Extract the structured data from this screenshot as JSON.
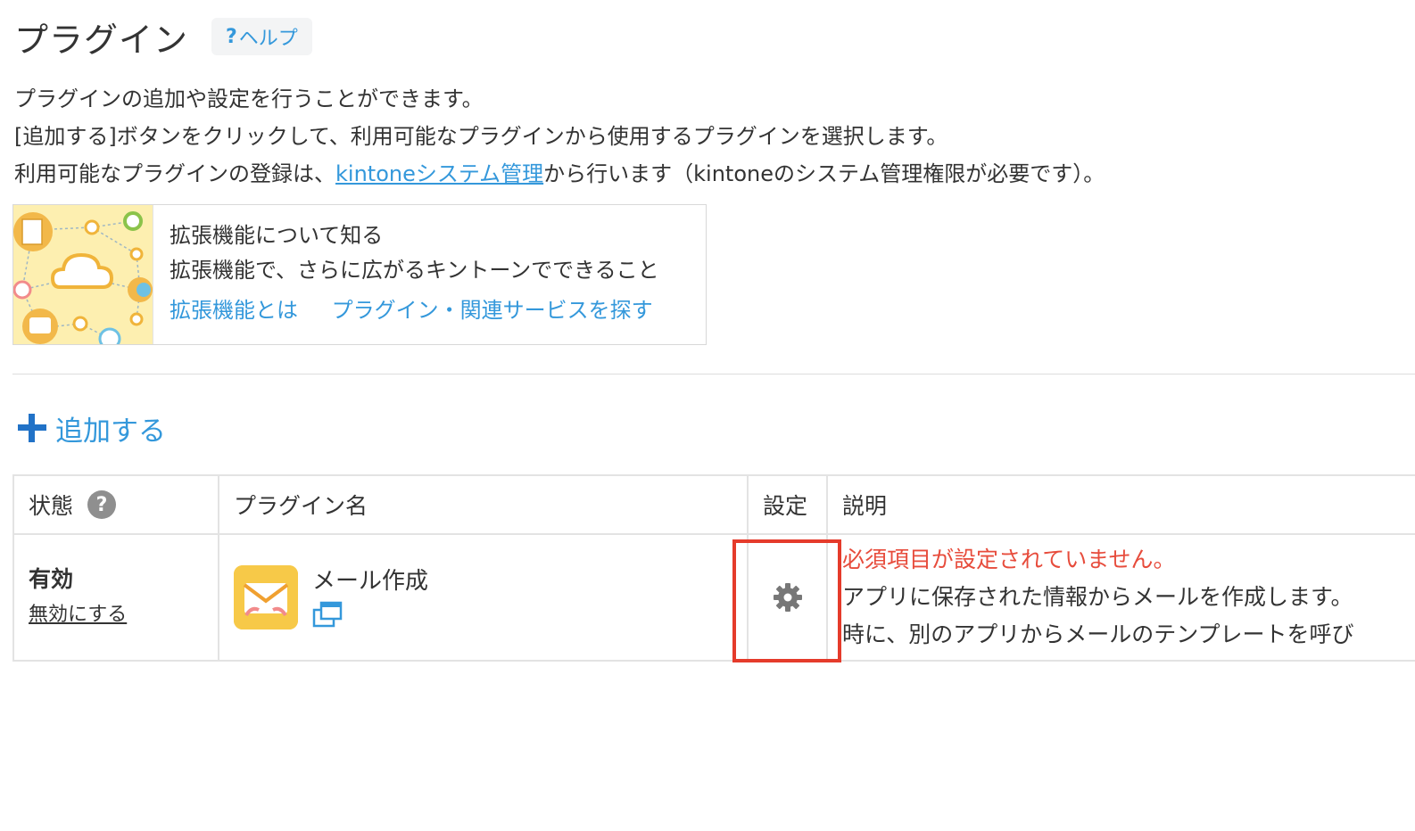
{
  "header": {
    "title": "プラグイン",
    "help_label": "ヘルプ",
    "help_mark": "?"
  },
  "intro": {
    "line1": "プラグインの追加や設定を行うことができます。",
    "line2": "[追加する]ボタンをクリックして、利用可能なプラグインから使用するプラグインを選択します。",
    "line3_pre": "利用可能なプラグインの登録は、",
    "line3_link": "kintoneシステム管理",
    "line3_post": "から行います（kintoneのシステム管理権限が必要です）。"
  },
  "promo": {
    "title": "拡張機能について知る",
    "subtitle": "拡張機能で、さらに広がるキントーンでできること",
    "link1": "拡張機能とは",
    "link2": "プラグイン・関連サービスを探す"
  },
  "add_button": {
    "label": "追加する"
  },
  "table": {
    "headers": {
      "status": "状態",
      "status_help": "?",
      "name": "プラグイン名",
      "settings": "設定",
      "description": "説明"
    },
    "rows": [
      {
        "status": "有効",
        "toggle": "無効にする",
        "name": "メール作成",
        "warning": "必須項目が設定されていません。",
        "desc_line1": "アプリに保存された情報からメールを作成します。",
        "desc_line2": "時に、別のアプリからメールのテンプレートを呼び"
      }
    ]
  },
  "colors": {
    "link": "#3498db",
    "warning": "#e74c3c",
    "highlight": "#e53b2b",
    "plugin_icon": "#f7c948"
  }
}
